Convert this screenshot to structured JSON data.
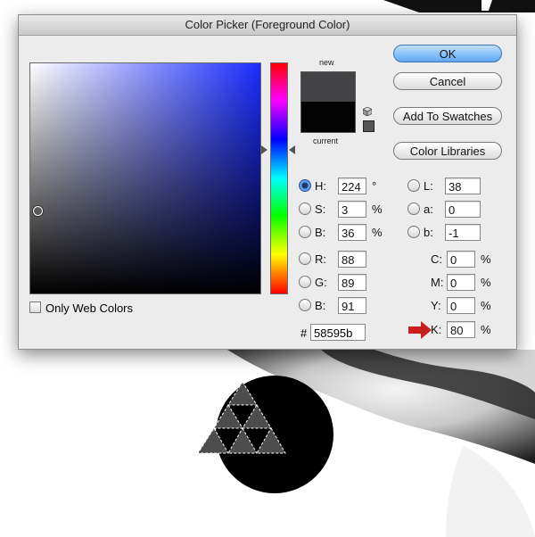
{
  "dialog": {
    "title": "Color Picker (Foreground Color)",
    "label_new": "new",
    "label_current": "current",
    "only_web_colors_label": "Only Web Colors",
    "new_color": "#434345",
    "current_color": "#040404"
  },
  "buttons": {
    "ok": "OK",
    "cancel": "Cancel",
    "add_to_swatches": "Add To Swatches",
    "color_libraries": "Color Libraries"
  },
  "hsb": {
    "h": {
      "label": "H:",
      "value": "224",
      "unit": "°"
    },
    "s": {
      "label": "S:",
      "value": "3",
      "unit": "%"
    },
    "b": {
      "label": "B:",
      "value": "36",
      "unit": "%"
    }
  },
  "rgb": {
    "r": {
      "label": "R:",
      "value": "88"
    },
    "g": {
      "label": "G:",
      "value": "89"
    },
    "b": {
      "label": "B:",
      "value": "91"
    }
  },
  "lab": {
    "l": {
      "label": "L:",
      "value": "38"
    },
    "a": {
      "label": "a:",
      "value": "0"
    },
    "b": {
      "label": "b:",
      "value": "-1"
    }
  },
  "cmyk": {
    "c": {
      "label": "C:",
      "value": "0",
      "unit": "%"
    },
    "m": {
      "label": "M:",
      "value": "0",
      "unit": "%"
    },
    "y": {
      "label": "Y:",
      "value": "0",
      "unit": "%"
    },
    "k": {
      "label": "K:",
      "value": "80",
      "unit": "%"
    }
  },
  "hex": {
    "hash": "#",
    "value": "58595b"
  },
  "icons": {
    "gamut_cube": "cube-icon",
    "arrow": "red-arrow-icon"
  },
  "colors": {
    "accent_arrow": "#c8201e",
    "ok_button": "#5ea6f2"
  }
}
